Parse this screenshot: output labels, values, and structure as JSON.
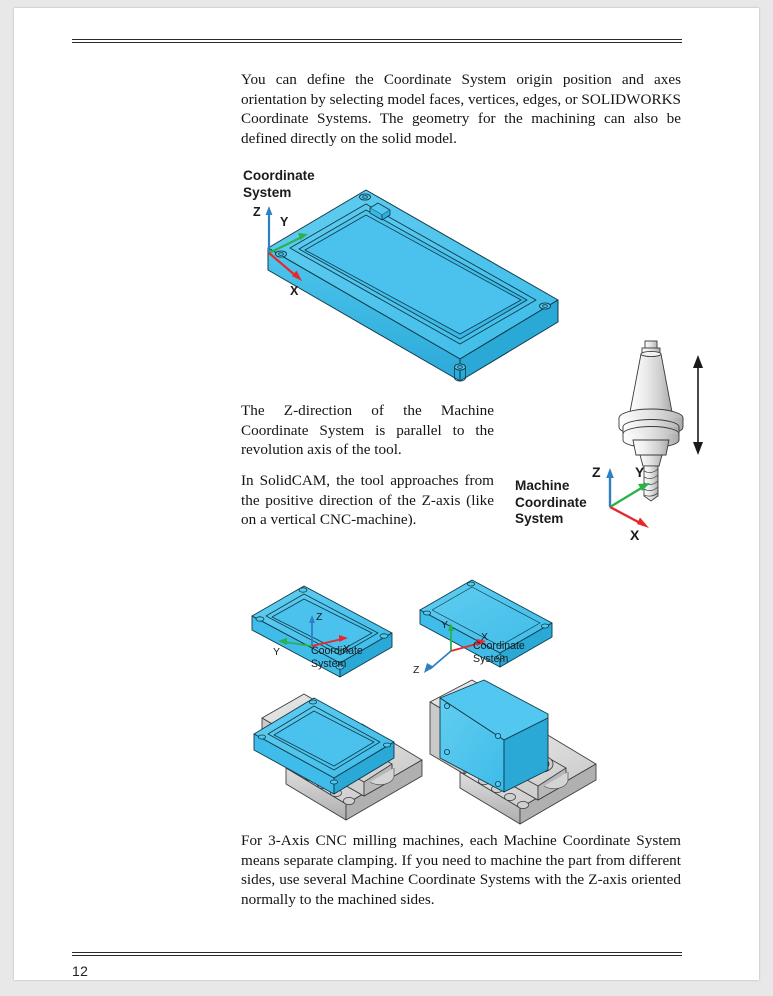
{
  "document": {
    "page_number": "12",
    "colors": {
      "part_cyan": "#45c3ec",
      "part_cyan_dark": "#2aa8d6",
      "part_cyan_light": "#7dd8f2",
      "fixture_gray": "#d8d8d8",
      "fixture_gray_dark": "#b4b4b4",
      "axis_x_red": "#e8272c",
      "axis_y_green": "#2ab34a",
      "axis_z_blue": "#2f7fc4",
      "rule_black": "#2b2b2b",
      "text_black": "#151515"
    }
  },
  "paragraphs": {
    "intro": "You can define the Coordinate System origin position and axes orientation by selecting model faces, vertices, edges, or SOLIDWORKS Coordinate Systems. The geometry for the machining can also be defined directly on the solid model.",
    "z_direction": "The Z-direction of the Machine Coordinate System is parallel to the revolution axis of the tool.",
    "tool_approach": "In SolidCAM, the tool approaches from the positive direction of the Z-axis (like on a vertical CNC-machine).",
    "clamping": "For 3-Axis CNC milling machines, each Machine Coordinate System means separate clamping. If you need to machine the part from different sides, use several Machine Coordinate Systems with the Z-axis oriented normally to the machined sides."
  },
  "callouts": {
    "coordinate_system_main": "Coordinate\nSystem",
    "machine_coordinate_system": "Machine\nCoordinate\nSystem",
    "coordinate_system_fig1": "Coordinate\nSystem",
    "coordinate_system_fig2": "Coordinate\nSystem"
  },
  "axes_labels": {
    "x": "X",
    "y": "Y",
    "z": "Z"
  },
  "figures": [
    {
      "id": "fig-main",
      "name": "isometric-pocket-plate",
      "caption": "Coordinate System",
      "description": "Cyan isometric rectangular plate with machined rectangular pocket, corner bosses and axis triad at the near-left corner"
    },
    {
      "id": "fig-tool",
      "name": "cnc-tool-holder",
      "description": "Tapered CNC tool holder with flange discs, end mill with helical flutes and a vertical double-headed arrow showing the revolution axis"
    },
    {
      "id": "fig-mcs-axes",
      "name": "machine-coordinate-system-axes",
      "description": "Axis triad: Z blue pointing up, Y green up-right, X red down-right"
    },
    {
      "id": "fig-a",
      "name": "part-pocket-up",
      "caption": "Coordinate System",
      "description": "Small cyan plate with pocket facing up, triad at front corner with Z up"
    },
    {
      "id": "fig-b",
      "name": "part-pocket-down",
      "caption": "Coordinate System",
      "description": "Small cyan plate flipped with pocket facing down, Z pointing down-left"
    },
    {
      "id": "fig-c",
      "name": "part-clamped-pocket-up",
      "description": "Cyan plate with pocket up clamped in a gray machine vise on a slotted base"
    },
    {
      "id": "fig-d",
      "name": "part-clamped-pocket-down",
      "description": "Cyan plate flipped, solid face up, clamped in the same gray machine vise"
    }
  ]
}
